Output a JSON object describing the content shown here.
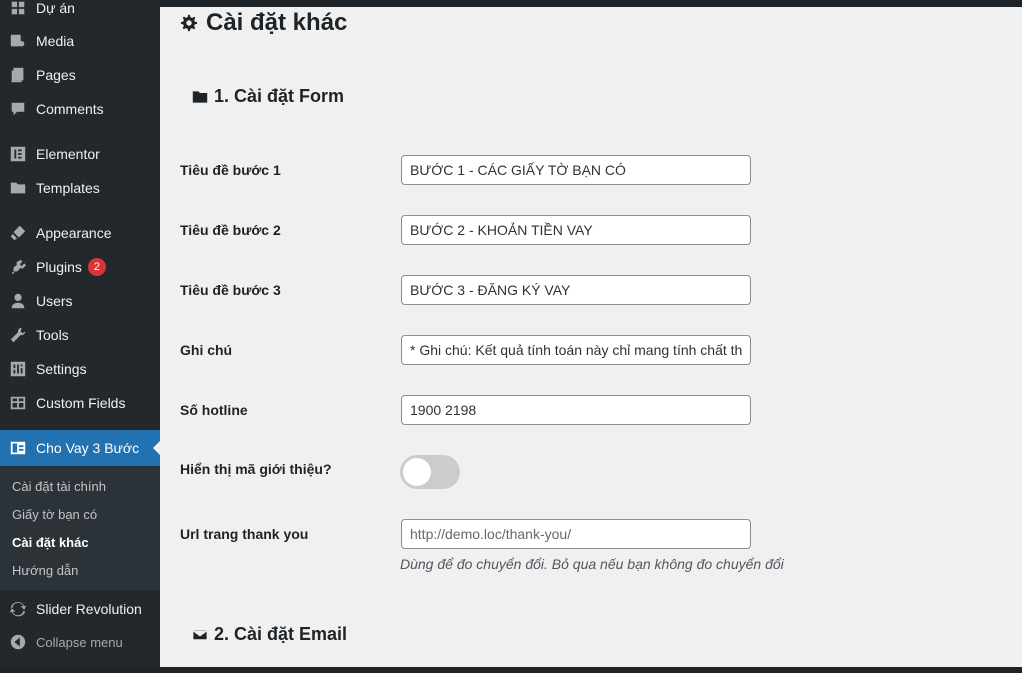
{
  "sidebar": {
    "items": [
      {
        "label": "Dự án",
        "icon": "pin-icon"
      },
      {
        "label": "Media",
        "icon": "media-icon"
      },
      {
        "label": "Pages",
        "icon": "pages-icon"
      },
      {
        "label": "Comments",
        "icon": "comments-icon"
      },
      {
        "label": "Elementor",
        "icon": "elementor-icon"
      },
      {
        "label": "Templates",
        "icon": "folder-icon"
      },
      {
        "label": "Appearance",
        "icon": "brush-icon"
      },
      {
        "label": "Plugins",
        "icon": "plugin-icon",
        "badge": "2"
      },
      {
        "label": "Users",
        "icon": "user-icon"
      },
      {
        "label": "Tools",
        "icon": "wrench-icon"
      },
      {
        "label": "Settings",
        "icon": "settings-icon"
      },
      {
        "label": "Custom Fields",
        "icon": "table-icon"
      },
      {
        "label": "Cho Vay 3 Bước",
        "icon": "form-icon"
      },
      {
        "label": "Slider Revolution",
        "icon": "refresh-icon"
      },
      {
        "label": "Collapse menu",
        "icon": "collapse-icon"
      }
    ],
    "submenu": [
      {
        "label": "Cài đặt tài chính"
      },
      {
        "label": "Giấy tờ bạn có"
      },
      {
        "label": "Cài đặt khác"
      },
      {
        "label": "Hướng dẫn"
      }
    ],
    "accent_color": "#2271b1",
    "badge_color": "#d63638"
  },
  "main": {
    "title": "Cài đặt khác",
    "section1": "1. Cài đặt Form",
    "section2": "2. Cài đặt Email",
    "fields": {
      "step1": {
        "label": "Tiêu đề bước 1",
        "value": "BƯỚC 1 - CÁC GIẤY TỜ BẠN CÓ"
      },
      "step2": {
        "label": "Tiêu đề bước 2",
        "value": "BƯỚC 2 - KHOẢN TIỀN VAY"
      },
      "step3": {
        "label": "Tiêu đề bước 3",
        "value": "BƯỚC 3 - ĐĂNG KÝ VAY"
      },
      "note": {
        "label": "Ghi chú",
        "value": "* Ghi chú: Kết quả tính toán này chỉ mang tính chất tham khảo"
      },
      "hotline": {
        "label": "Số hotline",
        "value": "1900 2198"
      },
      "referral": {
        "label": "Hiển thị mã giới thiệu?",
        "enabled": false
      },
      "thankyou": {
        "label": "Url trang thank you",
        "placeholder": "http://demo.loc/thank-you/",
        "hint": "Dùng để đo chuyển đổi. Bỏ qua nếu bạn không đo chuyển đổi"
      }
    }
  }
}
